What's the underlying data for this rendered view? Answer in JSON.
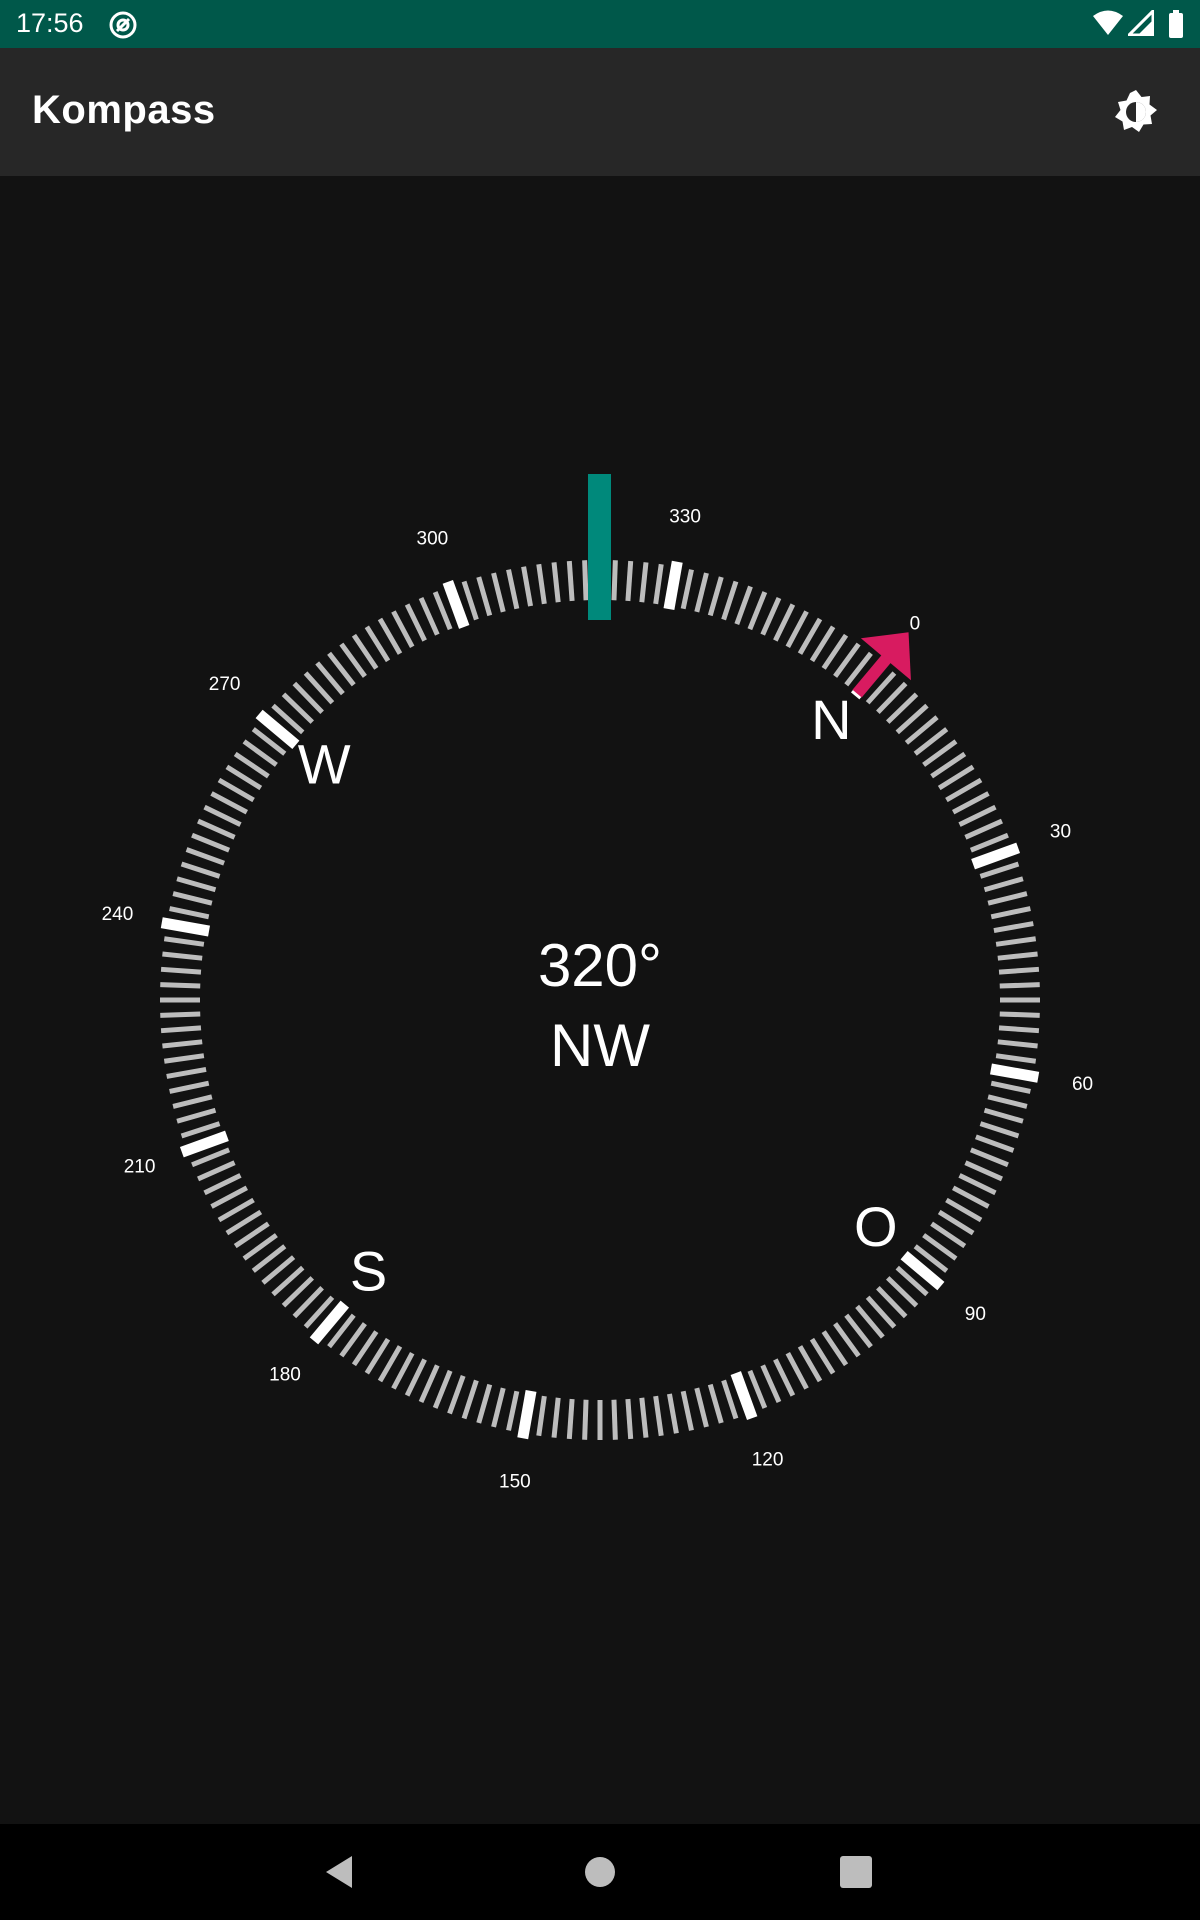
{
  "status_bar": {
    "time": "17:56",
    "icons": [
      "at-sign-icon",
      "wifi-icon",
      "signal-icon",
      "battery-icon"
    ]
  },
  "app_bar": {
    "title": "Kompass",
    "theme_button_icon": "brightness-icon"
  },
  "compass": {
    "heading_degrees": "320°",
    "heading_direction": "NW",
    "heading_value": 320,
    "scale_labels": [
      "0",
      "30",
      "60",
      "90",
      "120",
      "150",
      "180",
      "210",
      "240",
      "270",
      "300",
      "330"
    ],
    "cardinals": [
      "N",
      "O",
      "S",
      "W"
    ],
    "north_arrow_icon": "north-arrow-icon",
    "colors": {
      "background": "#121212",
      "heading_marker": "#00897b",
      "north_arrow": "#d81b60",
      "ticks_minor": "#bdbdbd",
      "ticks_major": "#ffffff"
    }
  },
  "nav_bar": {
    "icons": [
      "back-icon",
      "home-icon",
      "recents-icon"
    ]
  }
}
